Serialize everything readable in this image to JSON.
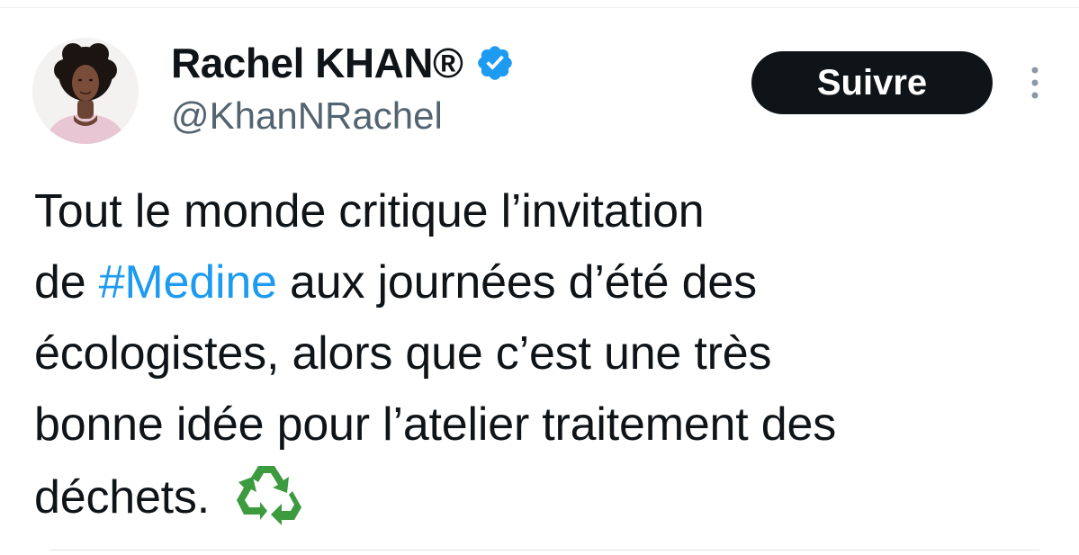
{
  "author": {
    "display_name": "Rachel KHAN®",
    "handle": "@KhanNRachel",
    "verified": true
  },
  "actions": {
    "follow_label": "Suivre"
  },
  "tweet": {
    "line1": "Tout le monde critique l’invitation",
    "line2_prefix": "de ",
    "hashtag": "#Medine",
    "line2_suffix": " aux journées d’été des",
    "line3": "écologistes, alors que c’est une très",
    "line4": "bonne idée pour l’atelier traitement des",
    "line5": "déchets. ",
    "emoji": "recycle-icon"
  },
  "colors": {
    "verified_badge": "#1d9bf0",
    "hashtag": "#1d9bf0",
    "follow_button_bg": "#0f1419",
    "recycle_green": "#3c9a3f"
  }
}
